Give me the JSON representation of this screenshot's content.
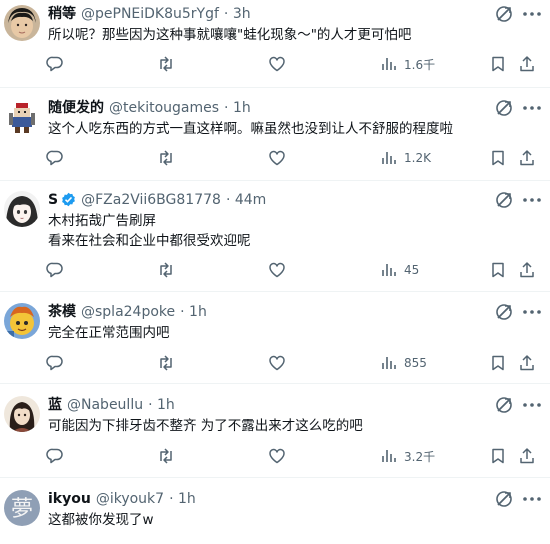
{
  "replies": [
    {
      "name": "稍等",
      "handle": "@pePNEiDK8u5rYgf",
      "time": "· 3h",
      "text": [
        "所以呢？那些因为这种事就嚷嚷\"蛙化现象～\"的人才更可怕吧"
      ],
      "views": "1.6千",
      "verified": false,
      "avatar": "avatar-face-dark-hair"
    },
    {
      "name": "随便发的",
      "handle": "@tekitougames",
      "time": "· 1h",
      "text": [
        "这个人吃东西的方式一直这样啊。嘛虽然也没到让人不舒服的程度啦"
      ],
      "views": "1.2K",
      "verified": false,
      "avatar": "avatar-game-character"
    },
    {
      "name": "S",
      "handle": "@FZa2Vii6BG81778",
      "time": "· 44m",
      "text": [
        "木村拓哉广告刷屏",
        "看来在社会和企业中都很受欢迎呢"
      ],
      "views": "45",
      "verified": true,
      "avatar": "avatar-anime-girl"
    },
    {
      "name": "茶模",
      "handle": "@spla24poke",
      "time": "· 1h",
      "text": [
        "完全在正常范围内吧"
      ],
      "views": "855",
      "verified": false,
      "avatar": "avatar-yellow-character"
    },
    {
      "name": "蓝",
      "handle": "@Nabeullu",
      "time": "· 1h",
      "text": [
        "可能因为下排牙齿不整齐 为了不露出来才这么吃的吧"
      ],
      "views": "3.2千",
      "verified": false,
      "avatar": "avatar-dark-hair-figure"
    },
    {
      "name": "ikyou",
      "handle": "@ikyouk7",
      "time": "· 1h",
      "text": [
        "这都被你发现了w"
      ],
      "views": "",
      "verified": false,
      "avatar": "avatar-kanji-dream"
    }
  ],
  "icons": {
    "reply": "reply-icon",
    "retweet": "retweet-icon",
    "like": "like-icon",
    "views": "views-icon",
    "bookmark": "bookmark-icon",
    "share": "share-icon",
    "grok": "grok-icon",
    "more": "more-icon"
  },
  "colors": {
    "verified": "#1d9bf0",
    "muted": "#536471",
    "text": "#0f1419"
  }
}
